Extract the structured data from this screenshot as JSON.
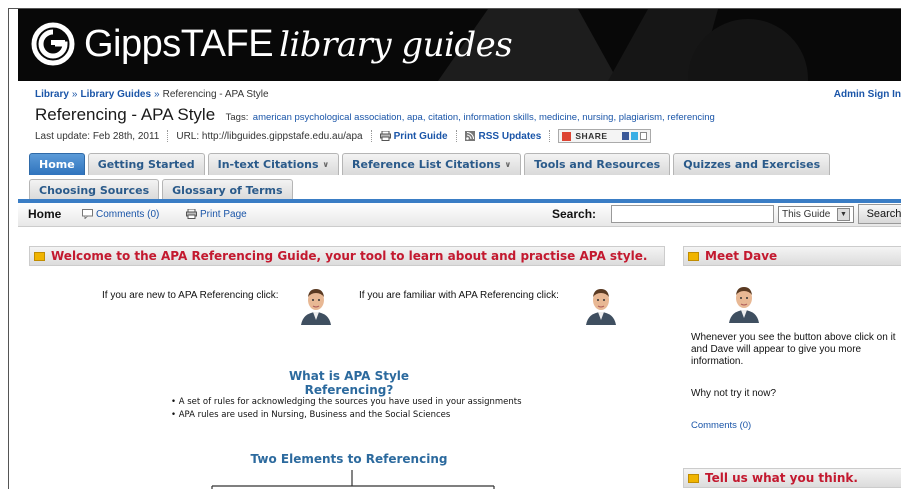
{
  "banner": {
    "brand": "GippsTAFE",
    "subtitle": "library guides"
  },
  "breadcrumb": [
    {
      "label": "Library",
      "link": true
    },
    {
      "label": "Library Guides",
      "link": true
    },
    {
      "label": "Referencing - APA Style",
      "link": false
    }
  ],
  "breadcrumb_sep": "»",
  "admin_link": "Admin Sign In",
  "page_title": "Referencing - APA Style",
  "tags_label": "Tags:",
  "tags": "american psychological association, apa, citation, information skills, medicine, nursing, plagiarism, referencing",
  "meta": {
    "last_update": "Last update: Feb 28th, 2011",
    "url": "URL: http://libguides.gippstafe.edu.au/apa",
    "print_guide": "Print Guide",
    "rss": "RSS Updates",
    "share": "SHARE"
  },
  "tabs_row1": [
    {
      "label": "Home",
      "active": true,
      "dropdown": false
    },
    {
      "label": "Getting Started",
      "active": false,
      "dropdown": false
    },
    {
      "label": "In-text Citations",
      "active": false,
      "dropdown": true
    },
    {
      "label": "Reference List Citations",
      "active": false,
      "dropdown": true
    },
    {
      "label": "Tools and Resources",
      "active": false,
      "dropdown": false
    },
    {
      "label": "Quizzes and Exercises",
      "active": false,
      "dropdown": false
    }
  ],
  "tabs_row2": [
    {
      "label": "Choosing Sources",
      "active": false
    },
    {
      "label": "Glossary of Terms",
      "active": false
    }
  ],
  "toolbar": {
    "home": "Home",
    "comments": "Comments (0)",
    "print_page": "Print Page",
    "search_label": "Search:",
    "search_value": "",
    "scope": "This Guide",
    "search_button": "Search"
  },
  "welcome": {
    "heading": "Welcome to the APA Referencing Guide, your tool to learn about and practise APA style.",
    "new_text": "If you are new to APA Referencing click:",
    "familiar_text": "If you are familiar with APA Referencing click:",
    "what_title": "What is APA Style Referencing?",
    "bullets": [
      "• A set of rules for acknowledging the sources you have used in your assignments",
      "• APA rules are used in Nursing, Business and the Social Sciences"
    ],
    "two_title": "Two Elements to Referencing"
  },
  "dave": {
    "heading": "Meet Dave",
    "text": "Whenever you see the button above click on it and Dave will appear to give you more information.",
    "try": "Why not try it now?",
    "comments": "Comments (0)"
  },
  "feedback": {
    "heading": "Tell us what you think."
  },
  "colors": {
    "accent_blue": "#3a7dc5",
    "heading_red": "#c3192f",
    "link_blue": "#1a55a8"
  }
}
